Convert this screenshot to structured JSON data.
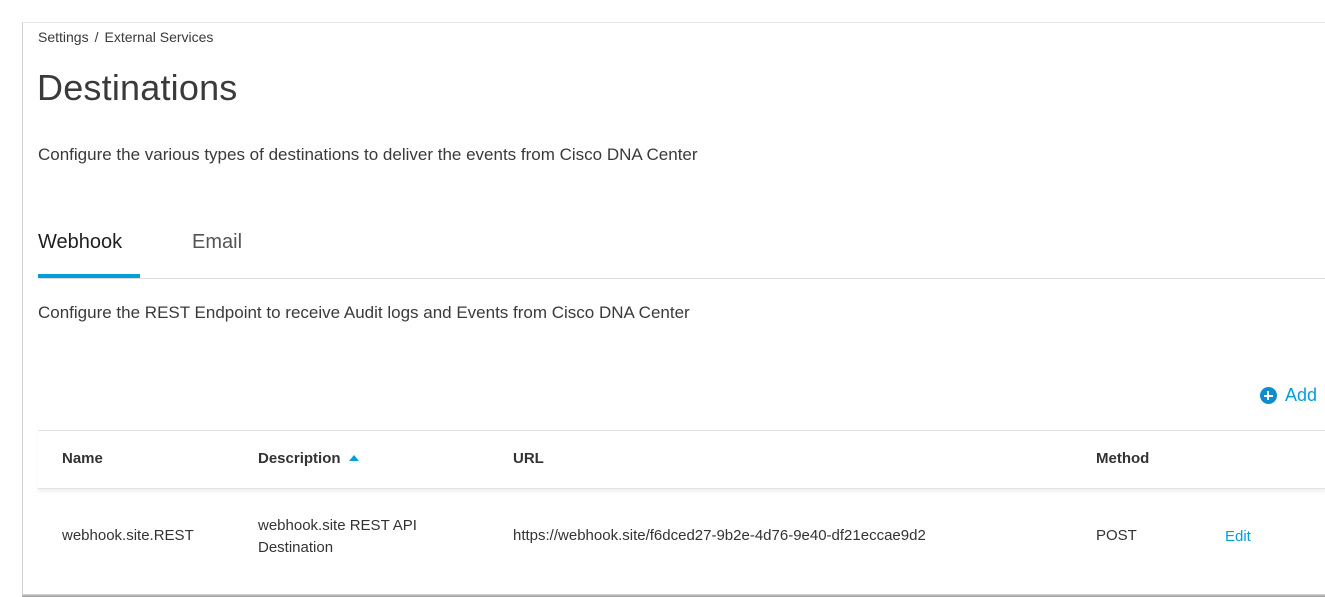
{
  "breadcrumb": {
    "items": [
      "Settings",
      "External Services"
    ],
    "separator": "/"
  },
  "page": {
    "title": "Destinations",
    "subtitle": "Configure the various types of destinations to deliver the events from Cisco DNA Center"
  },
  "tabs": [
    {
      "label": "Webhook",
      "active": true
    },
    {
      "label": "Email",
      "active": false
    }
  ],
  "webhook": {
    "description": "Configure the REST Endpoint to receive Audit logs and Events from Cisco DNA Center",
    "add_label": "Add",
    "table": {
      "columns": [
        "Name",
        "Description",
        "URL",
        "Method"
      ],
      "sort": {
        "column": "Description",
        "direction": "ascending"
      },
      "rows": [
        {
          "name": "webhook.site.REST",
          "description": "webhook.site REST API Destination",
          "url": "https://webhook.site/f6dced27-9b2e-4d76-9e40-df21eccae9d2",
          "method": "POST",
          "action": "Edit"
        }
      ]
    }
  },
  "colors": {
    "accent": "#049fd9",
    "add_icon": "#0e8ccd",
    "text": "#3a3a3a"
  },
  "icons": {
    "add": "plus-circle-icon",
    "sort": "sort-ascending-icon"
  }
}
